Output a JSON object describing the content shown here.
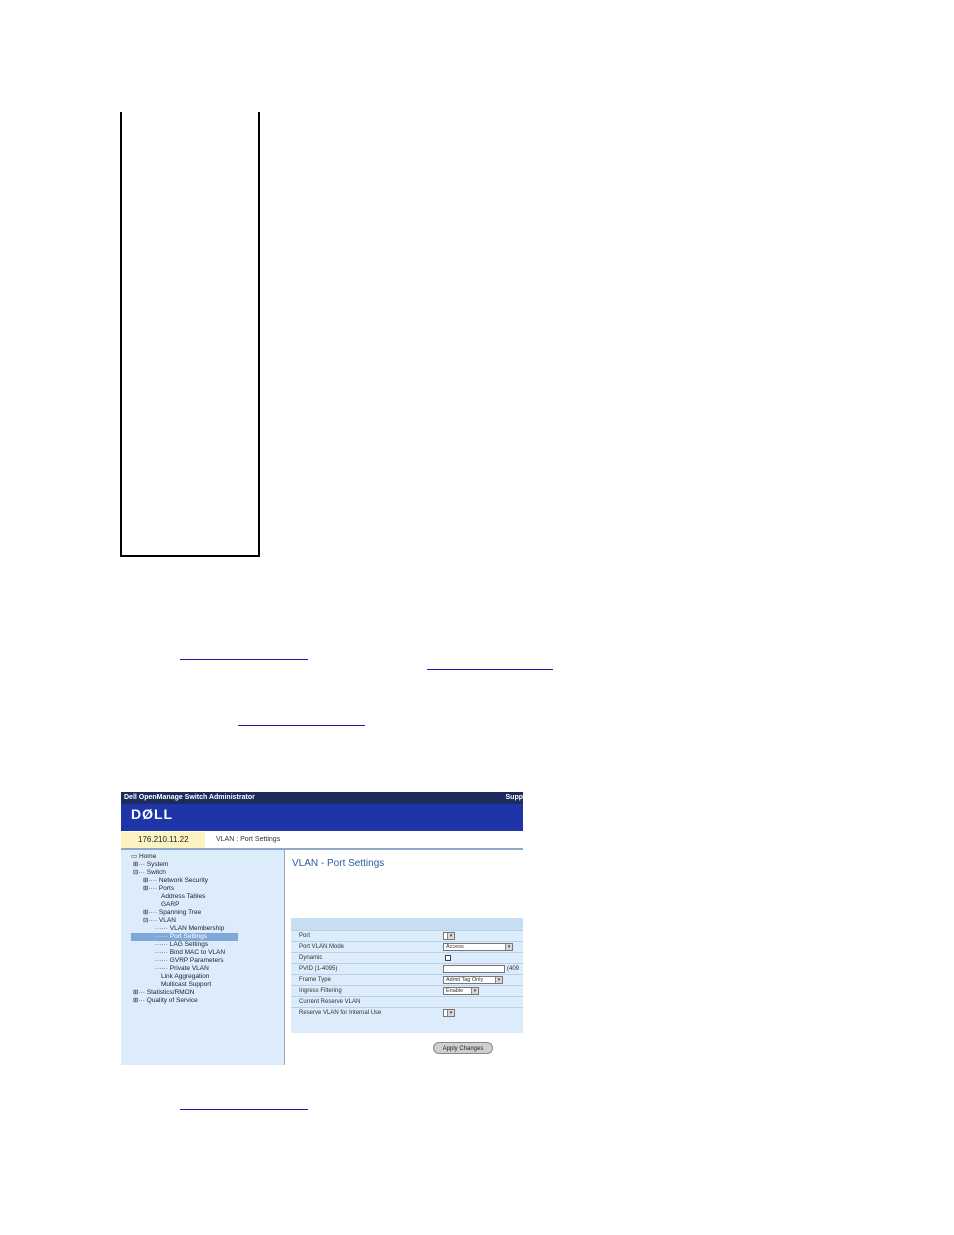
{
  "screenshot": {
    "titlebar": {
      "left": "Dell OpenManage Switch Administrator",
      "right": "Supp"
    },
    "logo": "DØLL",
    "ip": "176.210.11.22",
    "breadcrumb": "VLAN : Port Settings",
    "tree": {
      "items": [
        "Home",
        "System",
        "Switch",
        "Network Security",
        "Ports",
        "Address Tables",
        "GARP",
        "Spanning Tree",
        "VLAN",
        "VLAN Membership",
        "Port Settings",
        "LAG Settings",
        "Bind MAC to VLAN",
        "GVRP Parameters",
        "Private VLAN",
        "Link Aggregation",
        "Multicast Support",
        "Statistics/RMON",
        "Quality of Service"
      ]
    },
    "page_title": "VLAN - Port Settings",
    "form": {
      "labels": [
        "Port",
        "Port VLAN Mode",
        "Dynamic",
        "PVID (1-4095)",
        "Frame Type",
        "Ingress Filtering",
        "Current Reserve VLAN",
        "Reserve VLAN for Internal Use"
      ],
      "port_mode_value": "Access",
      "pvid_hint": "(409",
      "frame_type_value": "Admit Tag Only",
      "ingress_value": "Enable"
    },
    "apply_button": "Apply Changes"
  }
}
